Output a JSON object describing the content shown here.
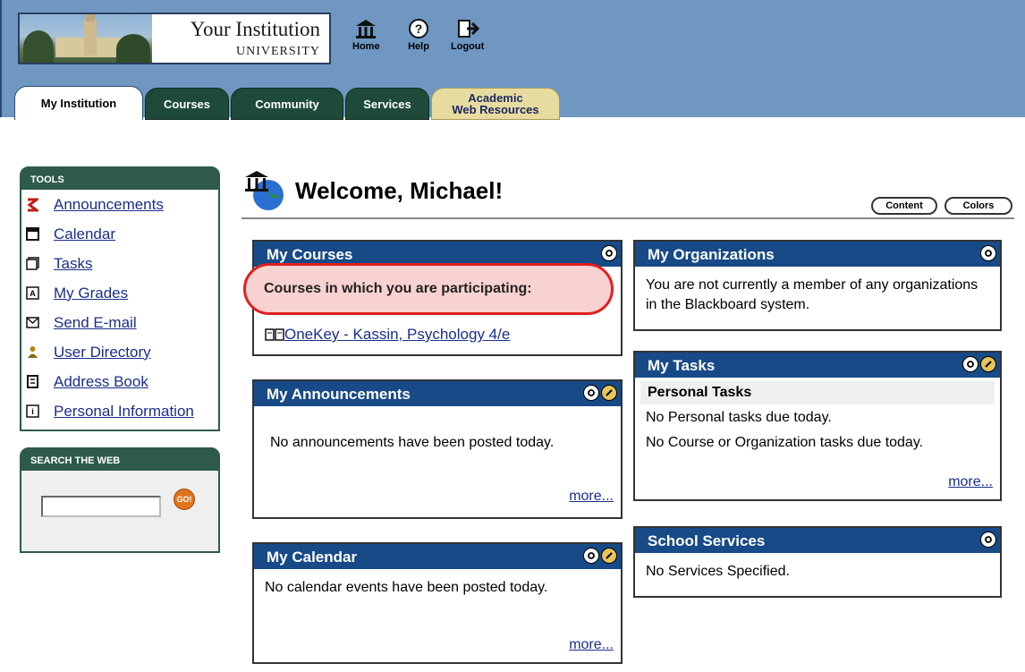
{
  "header": {
    "institution_name": "Your Institution",
    "institution_sub": "UNIVERSITY",
    "nav": {
      "home": "Home",
      "help": "Help",
      "logout": "Logout"
    }
  },
  "tabs": {
    "my_institution": "My Institution",
    "courses": "Courses",
    "community": "Community",
    "services": "Services",
    "academic_line1": "Academic",
    "academic_line2": "Web Resources"
  },
  "tools": {
    "title": "TOOLS",
    "items": [
      "Announcements",
      "Calendar",
      "Tasks",
      "My Grades",
      "Send E-mail",
      "User Directory",
      "Address Book",
      "Personal Information"
    ]
  },
  "search": {
    "title": "SEARCH THE WEB",
    "go_label": "GO!",
    "value": ""
  },
  "welcome": {
    "title": "Welcome, Michael!",
    "content_button": "Content",
    "colors_button": "Colors"
  },
  "my_courses": {
    "title": "My Courses",
    "highlight_text": "Courses in which you are participating:",
    "course_link": "OneKey - Kassin, Psychology 4/e"
  },
  "my_announcements": {
    "title": "My Announcements",
    "body": "No announcements have been posted today.",
    "more": "more..."
  },
  "my_calendar": {
    "title": "My Calendar",
    "body": "No calendar events have been posted today.",
    "more": "more..."
  },
  "my_organizations": {
    "title": "My Organizations",
    "body": "You are not currently a member of any organizations in the Blackboard system."
  },
  "my_tasks": {
    "title": "My Tasks",
    "subhead": "Personal Tasks",
    "line1": "No Personal tasks due today.",
    "line2": "No Course or Organization tasks due today.",
    "more": "more..."
  },
  "school_services": {
    "title": "School Services",
    "body": "No Services Specified."
  },
  "colors": {
    "header_bg": "#6f97c2",
    "tab_green": "#1f4a3a",
    "tab_gold": "#e8dba0",
    "module_head": "#174a87",
    "tools_head": "#2d5a4a",
    "highlight_border": "#e02020",
    "highlight_fill": "#f7d2d0",
    "link": "#1a2e8c"
  }
}
